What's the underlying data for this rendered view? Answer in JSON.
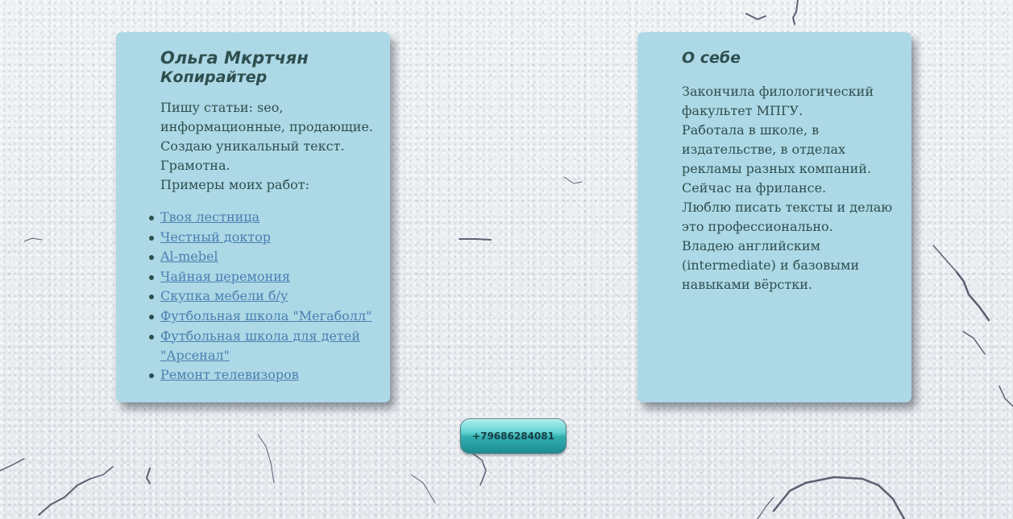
{
  "profile": {
    "name": "Ольга Мкртчян",
    "role": "Копирайтер",
    "intro": [
      "Пишу статьи: seo,",
      "информационные, продающие.",
      "Создаю уникальный текст.",
      "Грамотна.",
      "Примеры моих работ:"
    ],
    "works": [
      "Твоя лестница",
      "Честный доктор",
      "Al-mebel",
      "Чайная церемония",
      "Скупка мебели б/у",
      "Футбольная школа \"Мегаболл\"",
      "Футбольная школа для детей \"Арсенал\"",
      "Ремонт телевизоров"
    ]
  },
  "about": {
    "title": "О себе",
    "lines": [
      "Закончила филологический",
      "факультет МПГУ.",
      "Работала в школе, в",
      "издательстве, в отделах",
      "рекламы разных компаний.",
      "Сейчас на фрилансе.",
      "Люблю писать тексты и делаю",
      "это профессионально.",
      "Владею английским",
      "(intermediate) и базовыми",
      "навыками вёрстки."
    ]
  },
  "contact": {
    "phone": "+79686284081"
  },
  "colors": {
    "card": "#add8e6",
    "text": "#2f4f4f",
    "link": "#4a80b0",
    "button": "#32aeb0"
  }
}
